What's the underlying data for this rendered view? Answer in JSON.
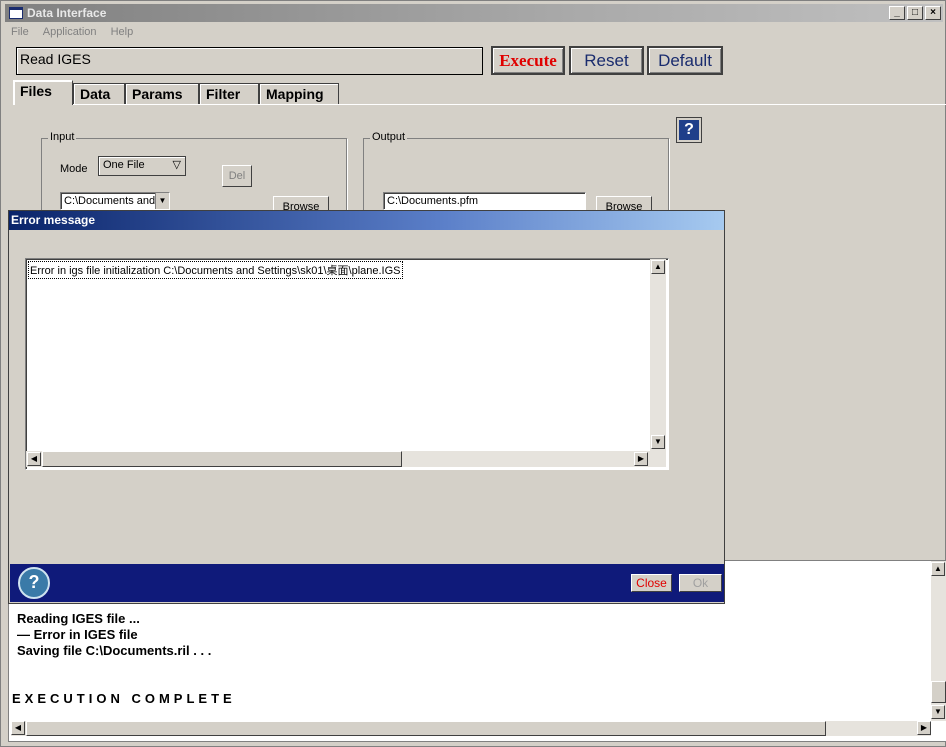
{
  "window": {
    "title": "Data Interface"
  },
  "menu": [
    "File",
    "Application",
    "Help"
  ],
  "command": {
    "text": "Read IGES"
  },
  "buttons": {
    "execute": "Execute",
    "reset": "Reset",
    "default": "Default",
    "execute_color": "#e00000",
    "reset_color": "#1a2c6e"
  },
  "tabs": [
    "Files",
    "Data",
    "Params",
    "Filter",
    "Mapping"
  ],
  "input": {
    "label": "Input",
    "mode_label": "Mode",
    "mode_value": "One File",
    "del_label": "Del",
    "file_value": "C:\\Documents and Se",
    "browse_label": "Browse"
  },
  "output": {
    "label": "Output",
    "file_value": "C:\\Documents.pfm",
    "browse_label": "Browse"
  },
  "console": {
    "lines": [
      "Reading IGES file ...",
      "— Error in IGES file",
      "Saving file C:\\Documents.ril . . ."
    ],
    "complete": "EXECUTION COMPLETE"
  },
  "dialog": {
    "title": "Error message",
    "error_text": "Error in igs file initialization C:\\Documents and Settings\\sk01\\桌面\\plane.IGS",
    "close_label": "Close",
    "ok_label": "Ok"
  },
  "icons": {
    "help": "help-icon",
    "dialog": "info-help-icon"
  }
}
